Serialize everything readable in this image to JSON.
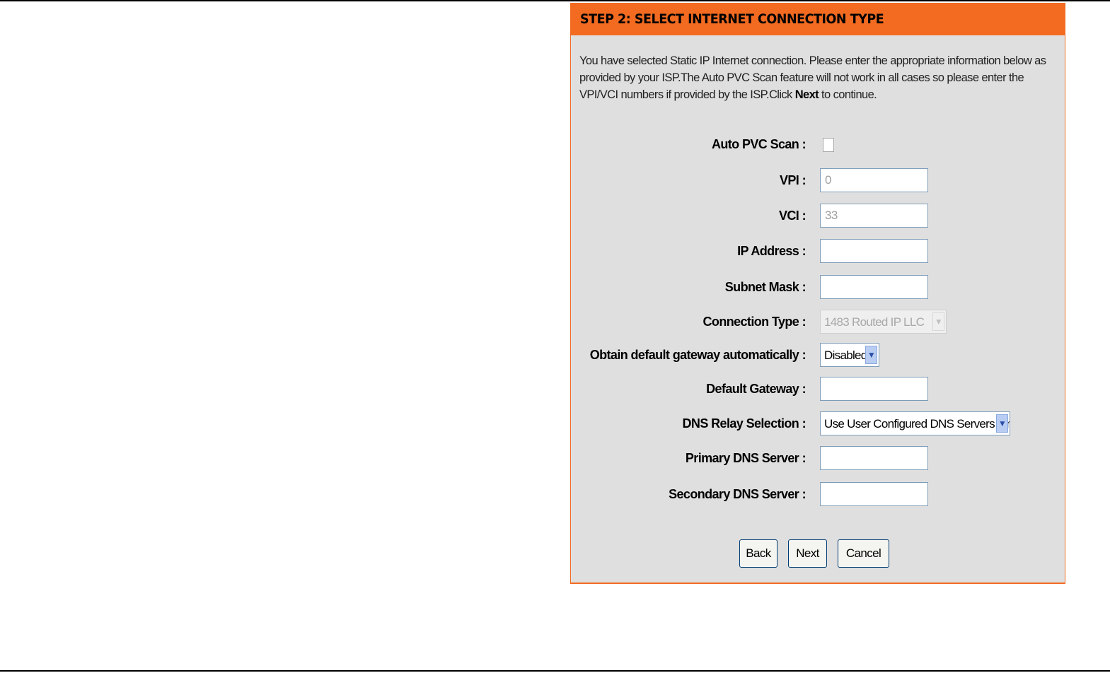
{
  "header": {
    "title": "STEP 2: SELECT INTERNET CONNECTION TYPE"
  },
  "intro": {
    "part1": "You have selected Static IP Internet connection. Please enter the appropriate information below as provided by your ISP.The Auto PVC Scan feature will not work in all cases so please enter the VPI/VCI numbers if provided by the ISP.Click ",
    "bold": "Next",
    "part2": " to continue."
  },
  "form": {
    "auto_pvc_scan": {
      "label": "Auto PVC Scan :",
      "checked": false
    },
    "vpi": {
      "label": "VPI :",
      "value": "0"
    },
    "vci": {
      "label": "VCI :",
      "value": "33"
    },
    "ip_address": {
      "label": "IP Address :",
      "value": ""
    },
    "subnet_mask": {
      "label": "Subnet Mask :",
      "value": ""
    },
    "connection_type": {
      "label": "Connection Type :",
      "selected": "1483 Routed IP LLC"
    },
    "obtain_gateway": {
      "label": "Obtain default gateway automatically :",
      "selected": "Disabled"
    },
    "default_gateway": {
      "label": "Default Gateway :",
      "value": ""
    },
    "dns_relay": {
      "label": "DNS Relay Selection :",
      "selected": "Use User Configured DNS Servers Only"
    },
    "primary_dns": {
      "label": "Primary DNS Server :",
      "value": ""
    },
    "secondary_dns": {
      "label": "Secondary DNS Server :",
      "value": ""
    }
  },
  "buttons": {
    "back": "Back",
    "next": "Next",
    "cancel": "Cancel"
  },
  "icons": {
    "dropdown": "chevron-down-icon"
  },
  "colors": {
    "accent": "#f26b21",
    "panel_bg": "#dfdfdf"
  }
}
